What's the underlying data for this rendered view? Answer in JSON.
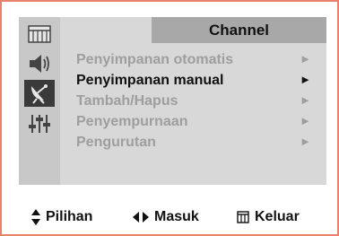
{
  "menu": {
    "title": "Channel",
    "items": [
      {
        "label": "Penyimpanan otomatis",
        "arrow": "►",
        "state": "disabled"
      },
      {
        "label": "Penyimpanan manual",
        "arrow": "►",
        "state": "selected"
      },
      {
        "label": "Tambah/Hapus",
        "arrow": "►",
        "state": "disabled"
      },
      {
        "label": "Penyempurnaan",
        "arrow": "►",
        "state": "disabled"
      },
      {
        "label": "Pengurutan",
        "arrow": "►",
        "state": "disabled"
      }
    ]
  },
  "sidebar": {
    "icons": [
      {
        "name": "picture-menu-icon",
        "active": false
      },
      {
        "name": "sound-icon",
        "active": false
      },
      {
        "name": "satellite-dish-icon",
        "active": true
      },
      {
        "name": "equalizer-settings-icon",
        "active": false
      }
    ]
  },
  "footer": {
    "select_label": "Pilihan",
    "enter_label": "Masuk",
    "exit_label": "Keluar"
  },
  "colors": {
    "frame_border": "#e8826a",
    "panel_bg": "#d8d8d8",
    "title_bg": "#a8a8a8",
    "active_icon_bg": "#3a3a3a",
    "disabled_text": "#9e9e9e"
  }
}
